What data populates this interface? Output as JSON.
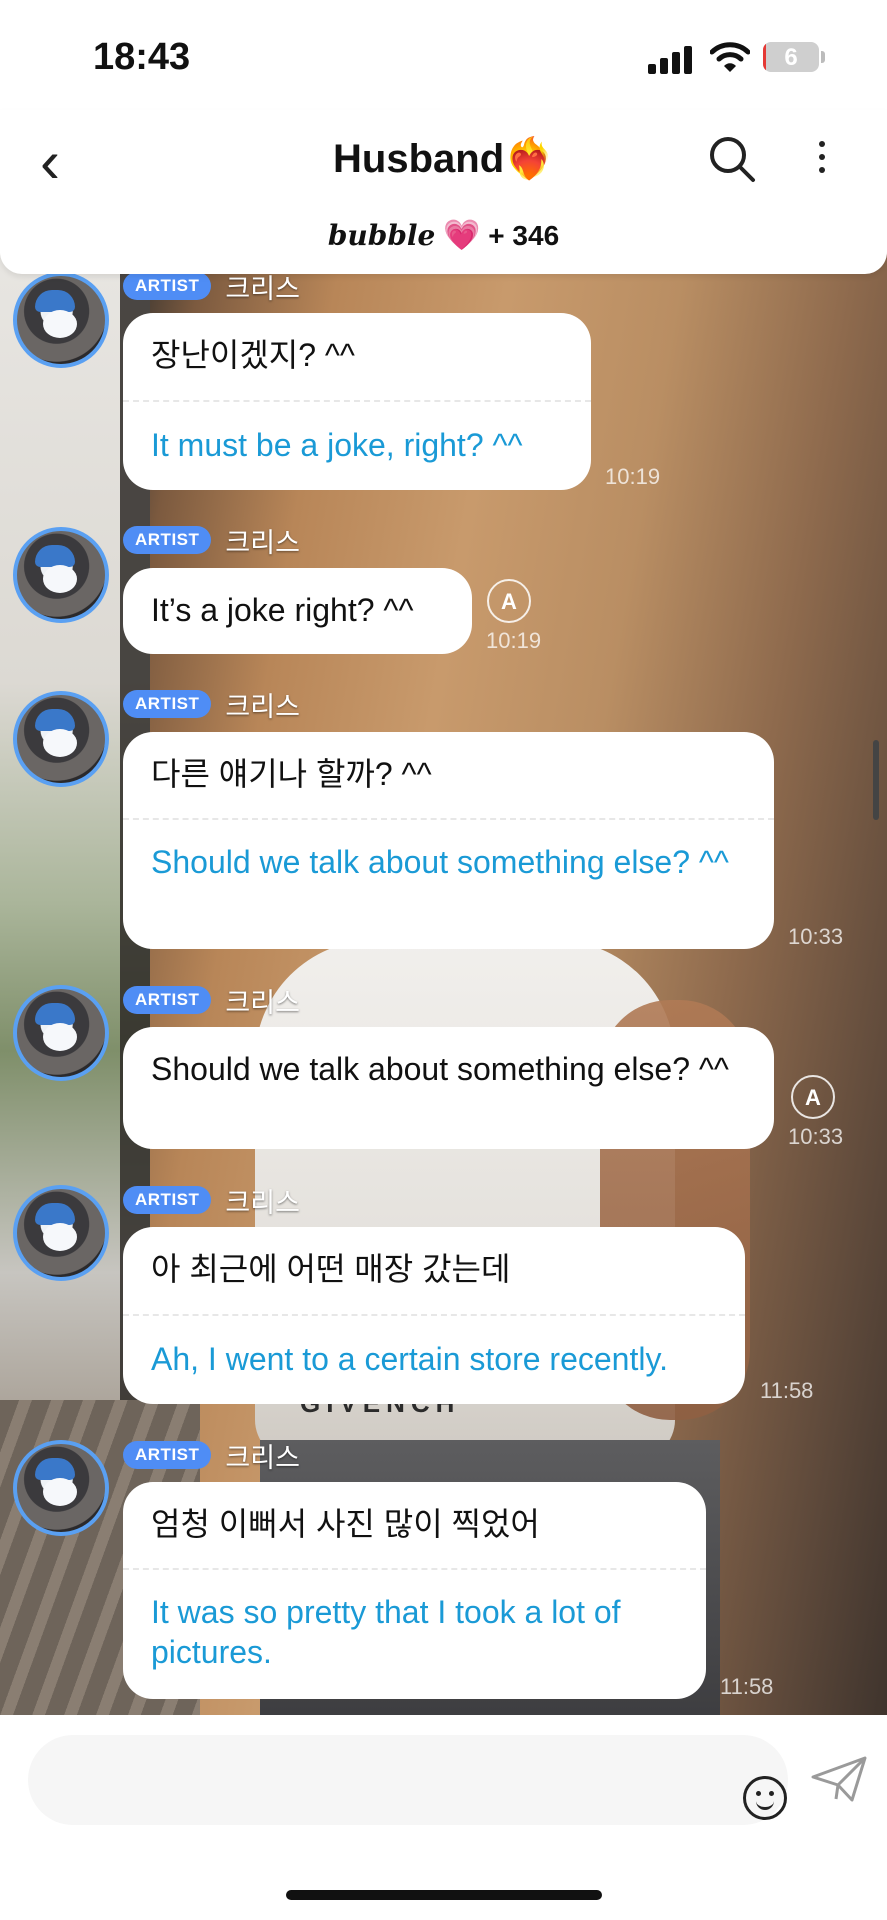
{
  "status": {
    "time": "18:43",
    "battery": "6",
    "battery_level": 0.06
  },
  "header": {
    "back": "‹",
    "title": "Husband",
    "title_emoji": "❤️‍🔥",
    "sub_brand": "bubble",
    "sub_heart": "💗",
    "sub_count": "+ 346"
  },
  "messages": [
    {
      "badge": "ARTIST",
      "sender": "크리스",
      "ko": "장난이겠지? ^^",
      "en": "It must be a joke, right? ^^",
      "time": "10:19"
    },
    {
      "badge": "ARTIST",
      "sender": "크리스",
      "text": "It’s a joke right? ^^",
      "time": "10:19",
      "translate_icon": "A"
    },
    {
      "badge": "ARTIST",
      "sender": "크리스",
      "ko": "다른 얘기나 할까? ^^",
      "en": "Should we talk about something else? ^^",
      "time": "10:33"
    },
    {
      "badge": "ARTIST",
      "sender": "크리스",
      "text": "Should we talk about something else? ^^",
      "time": "10:33",
      "translate_icon": "A"
    },
    {
      "badge": "ARTIST",
      "sender": "크리스",
      "ko": "아 최근에 어떤 매장 갔는데",
      "en": "Ah, I went to a certain store recently.",
      "time": "11:58"
    },
    {
      "badge": "ARTIST",
      "sender": "크리스",
      "ko": "엄청 이뻐서 사진 많이 찍었어",
      "en": "It was so pretty that I took a lot of pictures.",
      "time": "11:58"
    }
  ],
  "background": {
    "shirt_text": "GIVENCH"
  },
  "icons": {
    "search": "search-icon",
    "more": "more-vertical-icon",
    "emoji": "smiley-icon",
    "send": "send-icon"
  },
  "colors": {
    "badge": "#4f8df5",
    "translation": "#1a9ad6",
    "avatar_ring": "#5aa0f2"
  }
}
